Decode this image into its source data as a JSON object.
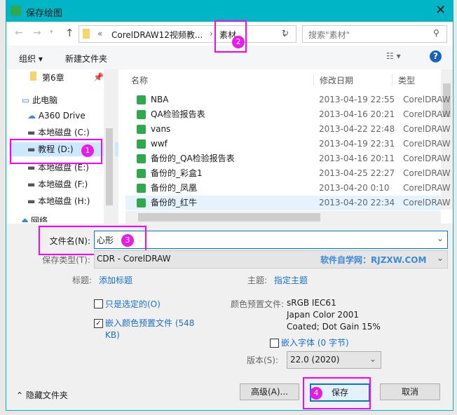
{
  "title": "保存绘图",
  "address": {
    "prefix": "«",
    "crumb1": "CorelDRAW12视频教...",
    "crumb2": "素材",
    "search_placeholder": "搜索\"素材\""
  },
  "toolbar": {
    "organize": "组织 ▾",
    "new_folder": "新建文件夹"
  },
  "nav": [
    {
      "label": "第6章"
    },
    {
      "label": "此电脑"
    },
    {
      "label": "A360 Drive"
    },
    {
      "label": "本地磁盘 (C:)"
    },
    {
      "label": "教程 (D:)"
    },
    {
      "label": "本地磁盘 (E:)"
    },
    {
      "label": "本地磁盘 (F:)"
    },
    {
      "label": "本地磁盘 (H:)"
    },
    {
      "label": "网络"
    }
  ],
  "columns": {
    "name": "名称",
    "date": "修改日期",
    "type": "类型"
  },
  "files": [
    {
      "name": "NBA",
      "date": "2013-04-19 22:55",
      "type": "CorelDRAW"
    },
    {
      "name": "QA检验报告表",
      "date": "2013-04-16 20:21",
      "type": "CorelDRAW"
    },
    {
      "name": "vans",
      "date": "2013-04-22 22:48",
      "type": "CorelDRAW"
    },
    {
      "name": "wwf",
      "date": "2013-04-19 22:31",
      "type": "CorelDRAW"
    },
    {
      "name": "备份的_QA检验报告表",
      "date": "2013-04-16 20:11",
      "type": "CorelDRAW"
    },
    {
      "name": "备份的_彩盒1",
      "date": "2013-04-25 22:27",
      "type": "CorelDRAW"
    },
    {
      "name": "备份的_凤凰",
      "date": "2013-04-20 0:10",
      "type": "CorelDRAW"
    },
    {
      "name": "备份的_红牛",
      "date": "2013-04-20 22:34",
      "type": "CorelDRAW"
    }
  ],
  "form": {
    "filename_label": "文件名(N):",
    "filename": "心形",
    "type_label": "保存类型(T):",
    "type": "CDR - CorelDRAW",
    "watermark": "软件自学网：RJZXW.COM",
    "title_label": "标题:",
    "title_link": "添加标题",
    "subject_label": "主题:",
    "subject_link": "指定主题",
    "only_selected": "只是选定的(O)",
    "embed_profile": "嵌入颜色预置文件 (548 KB)",
    "profile_label": "颜色预置文件:",
    "profile_lines": [
      "sRGB IEC61",
      "Japan Color 2001",
      "Coated; Dot Gain 15%"
    ],
    "embed_fonts": "嵌入字体 (0 字节)",
    "version_label": "版本(S):",
    "version": "22.0 (2020)"
  },
  "buttons": {
    "hide": "隐藏文件夹",
    "advanced": "高级(A)...",
    "save": "保存",
    "cancel": "取消"
  },
  "badges": [
    "1",
    "2",
    "3",
    "4"
  ]
}
